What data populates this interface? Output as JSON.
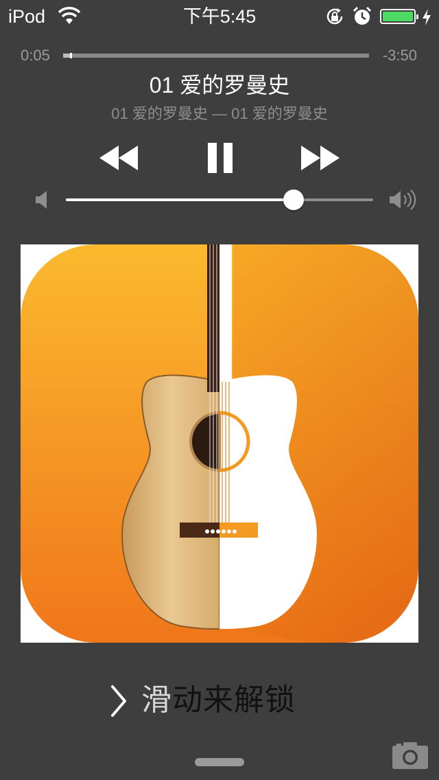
{
  "status_bar": {
    "carrier": "iPod",
    "time": "下午5:45",
    "battery_color": "#4cd964",
    "icons": [
      "wifi-icon",
      "rotation-lock-icon",
      "alarm-icon",
      "battery-icon",
      "charging-icon"
    ]
  },
  "now_playing": {
    "elapsed": "0:05",
    "remaining": "-3:50",
    "progress": 0.022,
    "title": "01 爱的罗曼史",
    "subtitle": "01 爱的罗曼史 — 01 爱的罗曼史",
    "volume": 0.74
  },
  "controls": {
    "icons": [
      "rewind-icon",
      "pause-icon",
      "fast-forward-icon",
      "volume-low-icon",
      "volume-high-icon"
    ]
  },
  "artwork": {
    "icon": "guitar-app-icon",
    "accent": "#f59a1c"
  },
  "lock_screen": {
    "unlock_shine": "滑",
    "unlock_rest": "动来解锁",
    "icons": [
      "chevron-right-icon",
      "camera-icon"
    ]
  }
}
